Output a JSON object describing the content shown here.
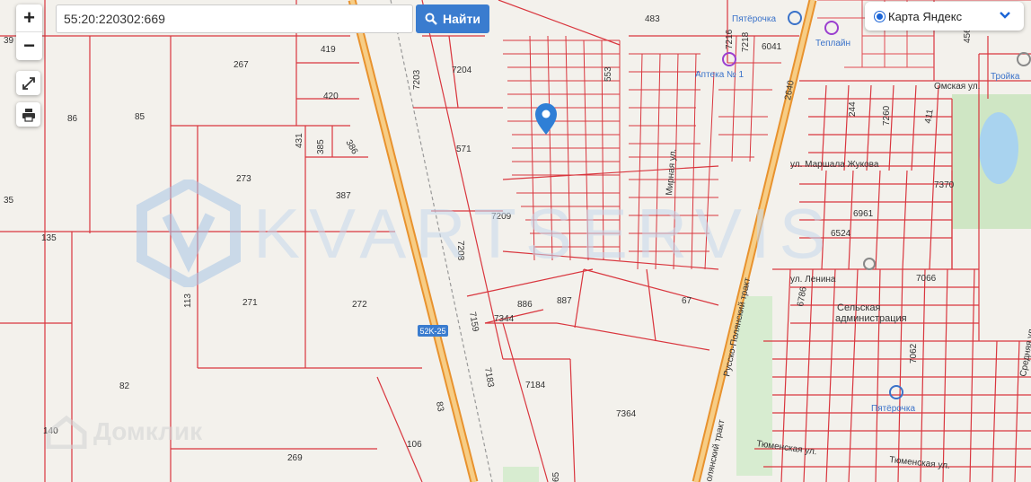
{
  "search": {
    "value": "55:20:220302:669",
    "button_label": "Найти"
  },
  "zoom": {
    "in_label": "+",
    "out_label": "−"
  },
  "layer_select": {
    "selected": "Карта Яндекс"
  },
  "watermarks": {
    "kvartservis": "KVARTSERVIS",
    "domclick": "Домклик"
  },
  "road_badge": "52K-25",
  "colors": {
    "parcel_line": "#d9363e",
    "highway": "#e8922e",
    "accent": "#3a7ccf",
    "marker": "#2f7fd6"
  },
  "streets": {
    "omskaya": "Омская ул.",
    "zhukova": "ул. Маршала Жукова",
    "lenina": "ул. Ленина",
    "trakt": "Русско-Полянский тракт",
    "trakt2": "олянский тракт",
    "tyumenskaya": "Тюменская ул.",
    "tyumenskaya2": "Тюменская ул.",
    "mirnaya": "Мирная ул.",
    "srednyaya": "Средняя ул."
  },
  "pois": {
    "pyaterochka_top": "Пятёрочка",
    "pyaterochka_bottom": "Пятёрочка",
    "apteka": "Аптека № 1",
    "teplaine": "Теплайн",
    "troika": "Тройка",
    "selskaya": "Сельская",
    "administration": "администрация"
  },
  "parcels": {
    "p483": "483",
    "p6041": "6041",
    "p7216": "7216",
    "p7218": "7218",
    "p419": "419",
    "p267": "267",
    "p7204": "7204",
    "p7203": "7203",
    "p553": "553",
    "p420": "420",
    "p86": "86",
    "p85": "85",
    "p571": "571",
    "p431": "431",
    "p385": "385",
    "p386": "386",
    "p273": "273",
    "p387": "387",
    "p135": "135",
    "p35": "35",
    "p7209": "7209",
    "p7208": "7208",
    "p271": "271",
    "p272": "272",
    "p113": "113",
    "p886": "886",
    "p887": "887",
    "p7344": "7344",
    "p7159": "7159",
    "p67": "67",
    "p82": "82",
    "p7183": "7183",
    "p7184": "7184",
    "p7364": "7364",
    "p140": "140",
    "p83": "83",
    "p106": "106",
    "p269": "269",
    "p65": "65",
    "p2640": "2640",
    "p244": "244",
    "p7260": "7260",
    "p411": "411",
    "p7370": "7370",
    "p6961": "6961",
    "p6524": "6524",
    "p7066": "7066",
    "p6786": "6786",
    "p7062": "7062",
    "p456": "456",
    "p39": "39"
  }
}
